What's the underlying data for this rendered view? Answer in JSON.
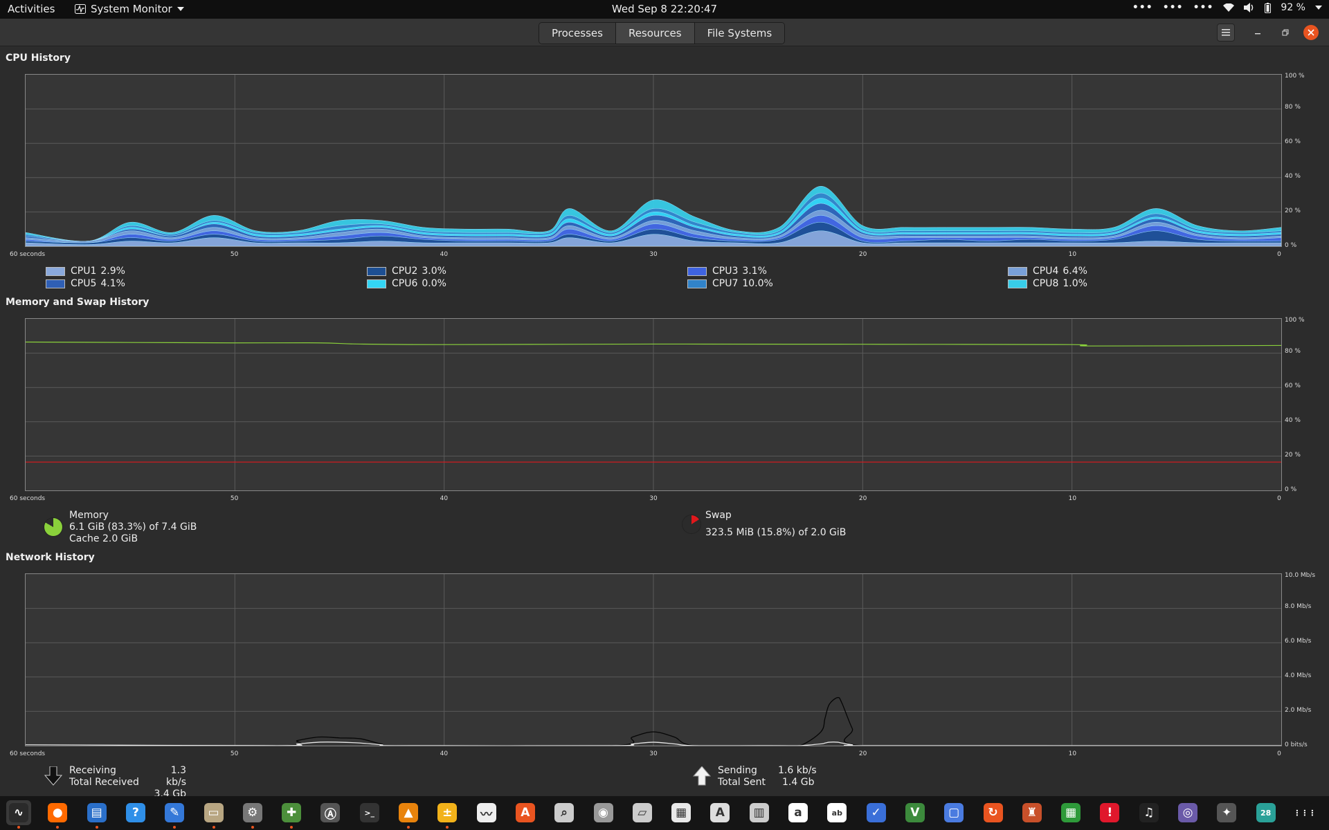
{
  "topbar": {
    "activities": "Activities",
    "app_menu": "System Monitor",
    "clock": "Wed Sep 8  22:20:47",
    "battery": "92 %",
    "tray_icons": [
      "more-icon",
      "more-icon",
      "more-icon",
      "wifi-icon",
      "volume-icon",
      "battery-icon",
      "chevron-down-icon"
    ]
  },
  "header": {
    "tabs": [
      "Processes",
      "Resources",
      "File Systems"
    ],
    "active_tab": "Resources"
  },
  "cpu": {
    "title": "CPU History",
    "x_ticks": [
      "60 seconds",
      "50",
      "40",
      "30",
      "20",
      "10",
      "0"
    ],
    "y_ticks": [
      "100 %",
      "80 %",
      "60 %",
      "40 %",
      "20 %",
      "0 %"
    ],
    "legend": [
      {
        "name": "CPU1",
        "value": "2.9%",
        "color": "#8aa9dc"
      },
      {
        "name": "CPU2",
        "value": "3.0%",
        "color": "#1d4f93"
      },
      {
        "name": "CPU3",
        "value": "3.1%",
        "color": "#3f63e0"
      },
      {
        "name": "CPU4",
        "value": "6.4%",
        "color": "#79a0d8"
      },
      {
        "name": "CPU5",
        "value": "4.1%",
        "color": "#2f5fb5"
      },
      {
        "name": "CPU6",
        "value": "0.0%",
        "color": "#33d5f4"
      },
      {
        "name": "CPU7",
        "value": "10.0%",
        "color": "#3183c9"
      },
      {
        "name": "CPU8",
        "value": "1.0%",
        "color": "#38cde9"
      }
    ]
  },
  "memory": {
    "title": "Memory and Swap History",
    "x_ticks": [
      "60 seconds",
      "50",
      "40",
      "30",
      "20",
      "10",
      "0"
    ],
    "y_ticks": [
      "100 %",
      "80 %",
      "60 %",
      "40 %",
      "20 %",
      "0 %"
    ],
    "memory_label": "Memory",
    "memory_usage": "6.1 GiB (83.3%) of 7.4 GiB",
    "memory_cache": "Cache 2.0 GiB",
    "memory_fraction": 0.833,
    "memory_color": "#8ad13b",
    "swap_label": "Swap",
    "swap_usage": "323.5 MiB (15.8%) of 2.0 GiB",
    "swap_fraction": 0.158,
    "swap_color": "#e0181c"
  },
  "network": {
    "title": "Network History",
    "x_ticks": [
      "60 seconds",
      "50",
      "40",
      "30",
      "20",
      "10",
      "0"
    ],
    "y_ticks": [
      "10.0 Mb/s",
      "8.0 Mb/s",
      "6.0 Mb/s",
      "4.0 Mb/s",
      "2.0 Mb/s",
      "0 bits/s"
    ],
    "receiving_label": "Receiving",
    "receiving_rate": "1.3 kb/s",
    "total_received_label": "Total Received",
    "total_received": "3.4 Gb",
    "sending_label": "Sending",
    "sending_rate": "1.6 kb/s",
    "total_sent_label": "Total Sent",
    "total_sent": "1.4 Gb"
  },
  "chart_data": [
    {
      "type": "area",
      "title": "CPU History",
      "xlabel": "",
      "ylabel": "",
      "x": [
        60,
        57,
        55,
        53,
        51,
        49,
        47,
        45,
        43,
        41,
        39,
        37,
        35,
        34,
        32,
        30,
        28,
        26,
        24,
        22,
        20,
        18,
        16,
        14,
        12,
        10,
        8,
        6,
        4,
        2,
        0
      ],
      "ylim": [
        0,
        100
      ],
      "xlim": [
        60,
        0
      ],
      "series": [
        {
          "name": "CPU1",
          "values": [
            2,
            1,
            3,
            2,
            5,
            2,
            2,
            2,
            3,
            2,
            2,
            2,
            2,
            5,
            2,
            7,
            3,
            2,
            2,
            9,
            2,
            2,
            2,
            2,
            2,
            2,
            2,
            3,
            2,
            2,
            2
          ]
        },
        {
          "name": "CPU2",
          "values": [
            1,
            1,
            2,
            1,
            2,
            1,
            1,
            2,
            3,
            2,
            1,
            1,
            1,
            2,
            1,
            3,
            2,
            1,
            2,
            5,
            1,
            1,
            2,
            1,
            2,
            1,
            2,
            6,
            2,
            1,
            1
          ]
        },
        {
          "name": "CPU3",
          "values": [
            1,
            0,
            2,
            1,
            2,
            1,
            1,
            2,
            2,
            1,
            1,
            1,
            1,
            3,
            1,
            3,
            2,
            1,
            1,
            4,
            2,
            2,
            1,
            2,
            1,
            1,
            1,
            3,
            2,
            1,
            2
          ]
        },
        {
          "name": "CPU4",
          "values": [
            1,
            1,
            2,
            1,
            2,
            1,
            1,
            2,
            2,
            1,
            1,
            1,
            1,
            2,
            1,
            2,
            2,
            1,
            1,
            3,
            2,
            1,
            1,
            1,
            1,
            1,
            1,
            2,
            1,
            1,
            1
          ]
        },
        {
          "name": "CPU5",
          "values": [
            1,
            0,
            1,
            1,
            2,
            1,
            1,
            1,
            1,
            1,
            1,
            1,
            1,
            2,
            1,
            3,
            2,
            1,
            1,
            4,
            1,
            1,
            1,
            1,
            1,
            1,
            1,
            2,
            1,
            1,
            1
          ]
        },
        {
          "name": "CPU6",
          "values": [
            0,
            0,
            1,
            0,
            1,
            1,
            1,
            1,
            1,
            1,
            1,
            1,
            1,
            2,
            1,
            2,
            1,
            1,
            1,
            3,
            1,
            1,
            1,
            1,
            1,
            1,
            1,
            1,
            1,
            1,
            1
          ]
        },
        {
          "name": "CPU7",
          "values": [
            1,
            0,
            1,
            1,
            1,
            1,
            1,
            2,
            1,
            1,
            1,
            1,
            1,
            2,
            1,
            2,
            2,
            1,
            1,
            3,
            1,
            1,
            1,
            1,
            1,
            1,
            1,
            2,
            1,
            1,
            1
          ]
        },
        {
          "name": "CPU8",
          "values": [
            1,
            0,
            2,
            1,
            3,
            1,
            1,
            3,
            2,
            2,
            2,
            2,
            1,
            4,
            1,
            5,
            3,
            1,
            2,
            4,
            2,
            2,
            2,
            2,
            2,
            2,
            2,
            3,
            2,
            1,
            2
          ]
        }
      ]
    },
    {
      "type": "line",
      "title": "Memory and Swap History",
      "xlabel": "",
      "ylabel": "",
      "x": [
        60,
        50,
        46,
        44,
        40,
        30,
        20,
        10,
        9,
        0
      ],
      "ylim": [
        0,
        100
      ],
      "xlim": [
        60,
        0
      ],
      "series": [
        {
          "name": "Memory",
          "values": [
            86.5,
            86,
            86,
            85.3,
            85,
            85.3,
            85.2,
            85,
            84.2,
            84.5
          ]
        },
        {
          "name": "Swap",
          "values": [
            16.5,
            16.5,
            16.5,
            16.5,
            16.5,
            16.5,
            16.5,
            16.5,
            16.5,
            16.5
          ]
        }
      ]
    },
    {
      "type": "line",
      "title": "Network History",
      "xlabel": "",
      "ylabel": "",
      "x": [
        60,
        48,
        47,
        46,
        45,
        44,
        43,
        42,
        32,
        31,
        30,
        29,
        28,
        24,
        23,
        22,
        21.8,
        21.6,
        21.2,
        21,
        20.5,
        20,
        10,
        0
      ],
      "ylim": [
        0,
        10
      ],
      "xlim": [
        60,
        0
      ],
      "series": [
        {
          "name": "Receiving",
          "values": [
            0,
            0,
            0.3,
            0.5,
            0.45,
            0.4,
            0.1,
            0,
            0,
            0.5,
            0.8,
            0.5,
            0,
            0,
            0,
            0.8,
            1.6,
            2.4,
            2.8,
            2.5,
            1.0,
            0,
            0,
            0
          ]
        },
        {
          "name": "Sending",
          "values": [
            0.05,
            0,
            0.1,
            0.2,
            0.2,
            0.15,
            0.05,
            0,
            0,
            0.1,
            0.2,
            0.1,
            0,
            0,
            0,
            0.1,
            0.15,
            0.2,
            0.2,
            0.15,
            0.05,
            0,
            0,
            0
          ]
        }
      ]
    }
  ],
  "dock": [
    {
      "icon": "system-monitor-icon",
      "color": "#2a2a2a",
      "glyph": "∿",
      "active": true,
      "running": true
    },
    {
      "icon": "firefox-icon",
      "color": "#ff6a00",
      "glyph": "●",
      "running": true
    },
    {
      "icon": "writer-icon",
      "color": "#2a6fc9",
      "glyph": "▤",
      "running": true
    },
    {
      "icon": "help-icon",
      "color": "#2f8fe8",
      "glyph": "?"
    },
    {
      "icon": "text-editor-icon",
      "color": "#3478d8",
      "glyph": "✎",
      "running": true
    },
    {
      "icon": "files-icon",
      "color": "#b8a682",
      "glyph": "▭",
      "running": true
    },
    {
      "icon": "settings-icon",
      "color": "#777777",
      "glyph": "⚙",
      "running": true
    },
    {
      "icon": "extensions-icon",
      "color": "#4c8f3b",
      "glyph": "✚",
      "running": true
    },
    {
      "icon": "software-updater-icon",
      "color": "#555555",
      "glyph": "Ⓐ"
    },
    {
      "icon": "terminal-icon",
      "color": "#333333",
      "glyph": ">_"
    },
    {
      "icon": "vlc-icon",
      "color": "#e8830c",
      "glyph": "▲",
      "running": true
    },
    {
      "icon": "calculator-icon",
      "color": "#f2b21a",
      "glyph": "±",
      "running": true
    },
    {
      "icon": "chart-app-icon",
      "color": "#eeeeee",
      "glyph": "〰"
    },
    {
      "icon": "app-store-icon",
      "color": "#e95420",
      "glyph": "A"
    },
    {
      "icon": "search-icon",
      "color": "#cccccc",
      "glyph": "⌕"
    },
    {
      "icon": "disk-icon",
      "color": "#999999",
      "glyph": "◉"
    },
    {
      "icon": "scanner-icon",
      "color": "#cccccc",
      "glyph": "▱"
    },
    {
      "icon": "document-viewer-icon",
      "color": "#e8e8e8",
      "glyph": "▦"
    },
    {
      "icon": "pdf-icon",
      "color": "#dddddd",
      "glyph": "A"
    },
    {
      "icon": "archive-icon",
      "color": "#cccccc",
      "glyph": "▥"
    },
    {
      "icon": "fonts-icon",
      "color": "#ffffff",
      "glyph": "a"
    },
    {
      "icon": "dictionary-icon",
      "color": "#ffffff",
      "glyph": "ab"
    },
    {
      "icon": "tasks-icon",
      "color": "#3a6fd8",
      "glyph": "✓"
    },
    {
      "icon": "vim-icon",
      "color": "#3c8a3c",
      "glyph": "V"
    },
    {
      "icon": "screenshot-icon",
      "color": "#4a7be0",
      "glyph": "▢"
    },
    {
      "icon": "backup-icon",
      "color": "#e95420",
      "glyph": "↻"
    },
    {
      "icon": "game-icon",
      "color": "#c8502a",
      "glyph": "♜"
    },
    {
      "icon": "spreadsheet-icon",
      "color": "#2e9a3a",
      "glyph": "▦"
    },
    {
      "icon": "alert-icon",
      "color": "#e0182c",
      "glyph": "!"
    },
    {
      "icon": "music-icon",
      "color": "#222222",
      "glyph": "♫"
    },
    {
      "icon": "camera-icon",
      "color": "#6a5aa8",
      "glyph": "◎"
    },
    {
      "icon": "gimp-icon",
      "color": "#555555",
      "glyph": "✦"
    },
    {
      "icon": "calendar-icon",
      "color": "#2aa198",
      "glyph": "28"
    },
    {
      "icon": "app-grid-icon",
      "color": "#151515",
      "glyph": "⋮⋮⋮"
    }
  ]
}
